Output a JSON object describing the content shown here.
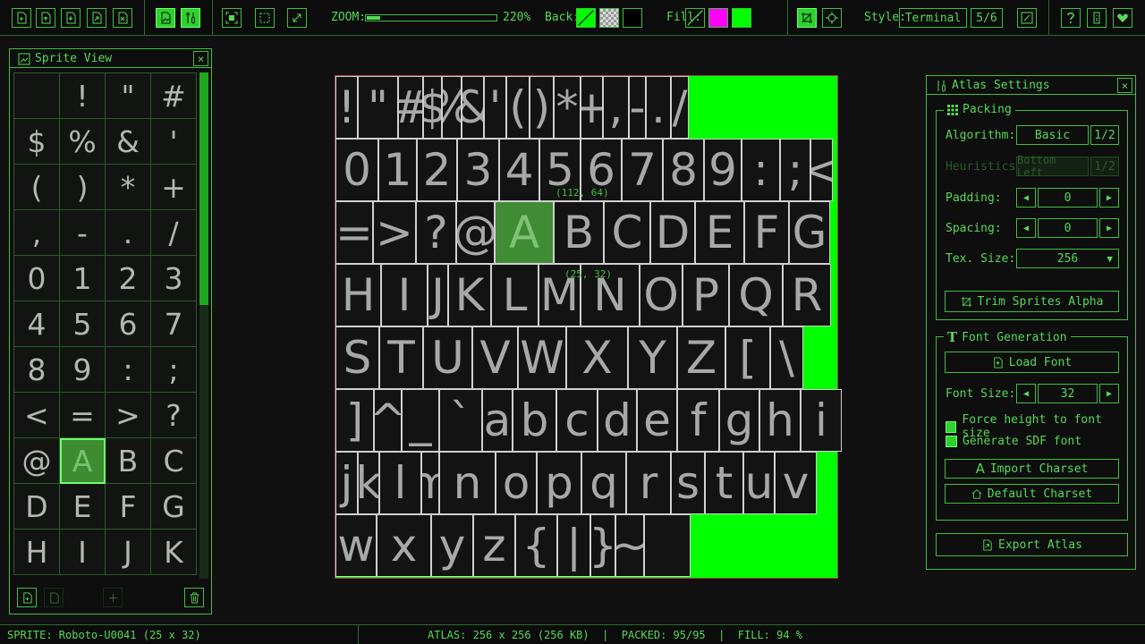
{
  "toolbar": {
    "zoom_label": "ZOOM:",
    "zoom_value": "220%",
    "zoom_fraction": 0.1,
    "back_label": "Back:",
    "fill_label": "Fill:",
    "style_label": "Style:",
    "style_value": "Terminal",
    "style_page": "5/6",
    "fill_colors": [
      "#ff00ff",
      "#00ff00"
    ],
    "back_color": "#00ff00"
  },
  "sprite_view": {
    "title": "Sprite View",
    "glyphs": [
      " ",
      "!",
      "\"",
      "#",
      "$",
      "%",
      "&",
      "'",
      "(",
      ")",
      "*",
      "+",
      ",",
      "-",
      ".",
      "/",
      "0",
      "1",
      "2",
      "3",
      "4",
      "5",
      "6",
      "7",
      "8",
      "9",
      ":",
      ";",
      "<",
      "=",
      ">",
      "?",
      "@",
      "A",
      "B",
      "C",
      "D",
      "E",
      "F",
      "G",
      "H",
      "I",
      "J",
      "K"
    ],
    "selected_index": 33
  },
  "atlas": {
    "glyphs": [
      "!",
      "\"",
      "#",
      "$",
      "%",
      "&",
      "'",
      "(",
      ")",
      "*",
      "+",
      ",",
      "-",
      ".",
      "/",
      "0",
      "1",
      "2",
      "3",
      "4",
      "5",
      "6",
      "7",
      "8",
      "9",
      ":",
      ";",
      "<",
      "=",
      ">",
      "?",
      "@",
      "A",
      "B",
      "C",
      "D",
      "E",
      "F",
      "G",
      "H",
      "I",
      "J",
      "K",
      "L",
      "M",
      "N",
      "O",
      "P",
      "Q",
      "R",
      "S",
      "T",
      "U",
      "V",
      "W",
      "X",
      "Y",
      "Z",
      "[",
      "\\",
      "]",
      "^",
      "_",
      "`",
      "a",
      "b",
      "c",
      "d",
      "e",
      "f",
      "g",
      "h",
      "i",
      "j",
      "k",
      "l",
      "m",
      "n",
      "o",
      "p",
      "q",
      "r",
      "s",
      "t",
      "u",
      "v",
      "w",
      "x",
      "y",
      "z",
      "{",
      "|",
      "}",
      "~"
    ],
    "selected": "A",
    "sel_position": "(112, 64)",
    "sel_size": "(25, 32)"
  },
  "settings": {
    "title": "Atlas Settings",
    "packing_title": "Packing",
    "algorithm_label": "Algorithm:",
    "algorithm_value": "Basic",
    "algorithm_page": "1/2",
    "heuristics_label": "Heuristics:",
    "heuristics_value": "Bottom Left",
    "heuristics_page": "1/2",
    "padding_label": "Padding:",
    "padding_value": "0",
    "spacing_label": "Spacing:",
    "spacing_value": "0",
    "texsize_label": "Tex. Size:",
    "texsize_value": "256",
    "trim_label": "Trim Sprites Alpha",
    "font_title": "Font Generation",
    "load_font_label": "Load Font",
    "fontsize_label": "Font Size:",
    "fontsize_value": "32",
    "force_height_label": "Force height to font size",
    "sdf_label": "Generate SDF font",
    "import_charset_label": "Import Charset",
    "default_charset_label": "Default Charset",
    "export_label": "Export Atlas"
  },
  "status": {
    "sprite": "SPRITE: Roboto-U0041 (25 x 32)",
    "atlas": "ATLAS: 256 x 256 (256 KB)  |  PACKED: 95/95  |  FILL: 94 %"
  }
}
